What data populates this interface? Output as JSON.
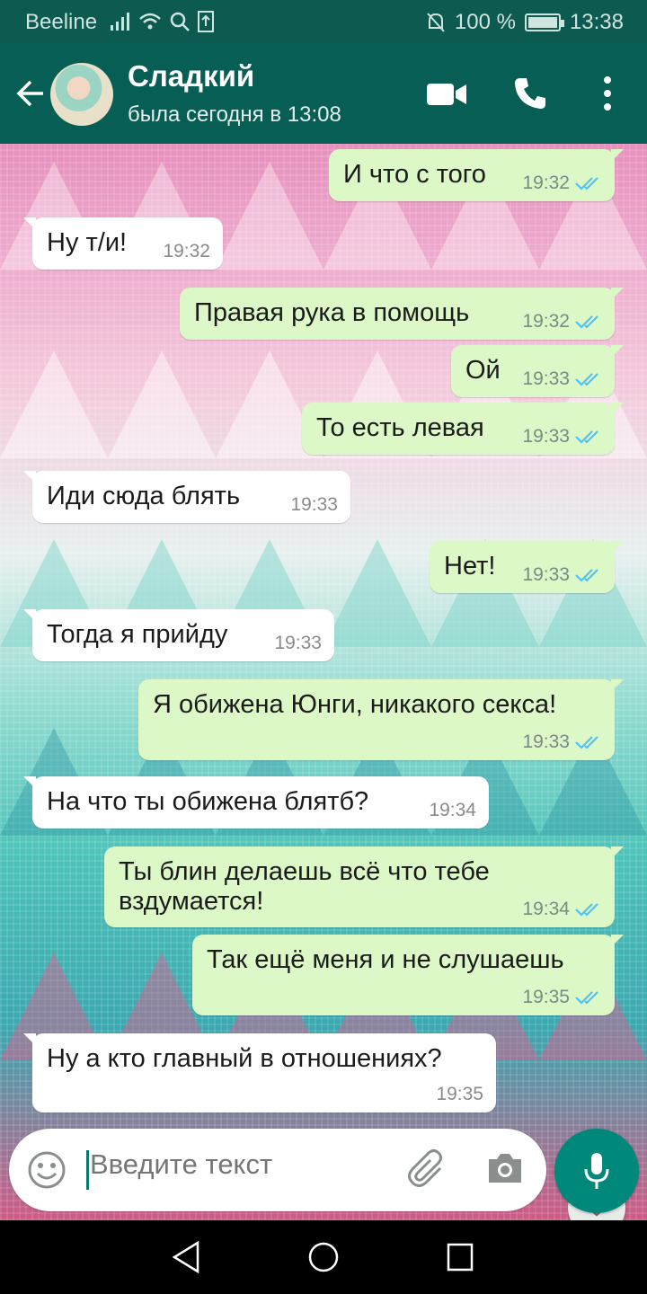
{
  "status_bar": {
    "carrier": "Beeline",
    "battery": "100 %",
    "time": "13:38",
    "battery_level": 1.0
  },
  "header": {
    "contact_name": "Сладкий",
    "last_seen": "была сегодня в 13:08"
  },
  "messages": [
    {
      "dir": "out",
      "text": "И что с того",
      "time": "19:32",
      "read": true
    },
    {
      "dir": "in",
      "text": "Ну т/и!",
      "time": "19:32"
    },
    {
      "dir": "out",
      "text": "Правая рука в помощь",
      "time": "19:32",
      "read": true
    },
    {
      "dir": "out",
      "text": "Ой",
      "time": "19:33",
      "read": true
    },
    {
      "dir": "out",
      "text": "То есть левая",
      "time": "19:33",
      "read": true
    },
    {
      "dir": "in",
      "text": "Иди сюда блять",
      "time": "19:33"
    },
    {
      "dir": "out",
      "text": "Нет!",
      "time": "19:33",
      "read": true
    },
    {
      "dir": "in",
      "text": "Тогда я прийду",
      "time": "19:33"
    },
    {
      "dir": "out",
      "text": "Я обижена Юнги, никакого секса!",
      "time": "19:33",
      "read": true
    },
    {
      "dir": "in",
      "text": "На что ты обижена блятб?",
      "time": "19:34"
    },
    {
      "dir": "out",
      "text": "Ты блин делаешь всё что тебе вздумается!",
      "time": "19:34",
      "read": true
    },
    {
      "dir": "out",
      "text": "Так ещё меня и не слушаешь",
      "time": "19:35",
      "read": true
    },
    {
      "dir": "in",
      "text": "Ну а кто главный в отношениях?",
      "time": "19:35"
    }
  ],
  "composer": {
    "placeholder": "Введите текст"
  },
  "colors": {
    "header": "#075e54",
    "status_bar": "#0d5a50",
    "outgoing_bubble": "#dcf8c6",
    "incoming_bubble": "#ffffff",
    "read_ticks": "#4fc3f7",
    "mic_button": "#00897b"
  },
  "icons": {
    "back": "arrow-left-icon",
    "video": "video-camera-icon",
    "call": "phone-icon",
    "menu": "more-vertical-icon",
    "emoji": "emoji-icon",
    "attach": "paperclip-icon",
    "camera": "camera-icon",
    "mic": "microphone-icon",
    "scroll_down": "double-chevron-down-icon"
  }
}
